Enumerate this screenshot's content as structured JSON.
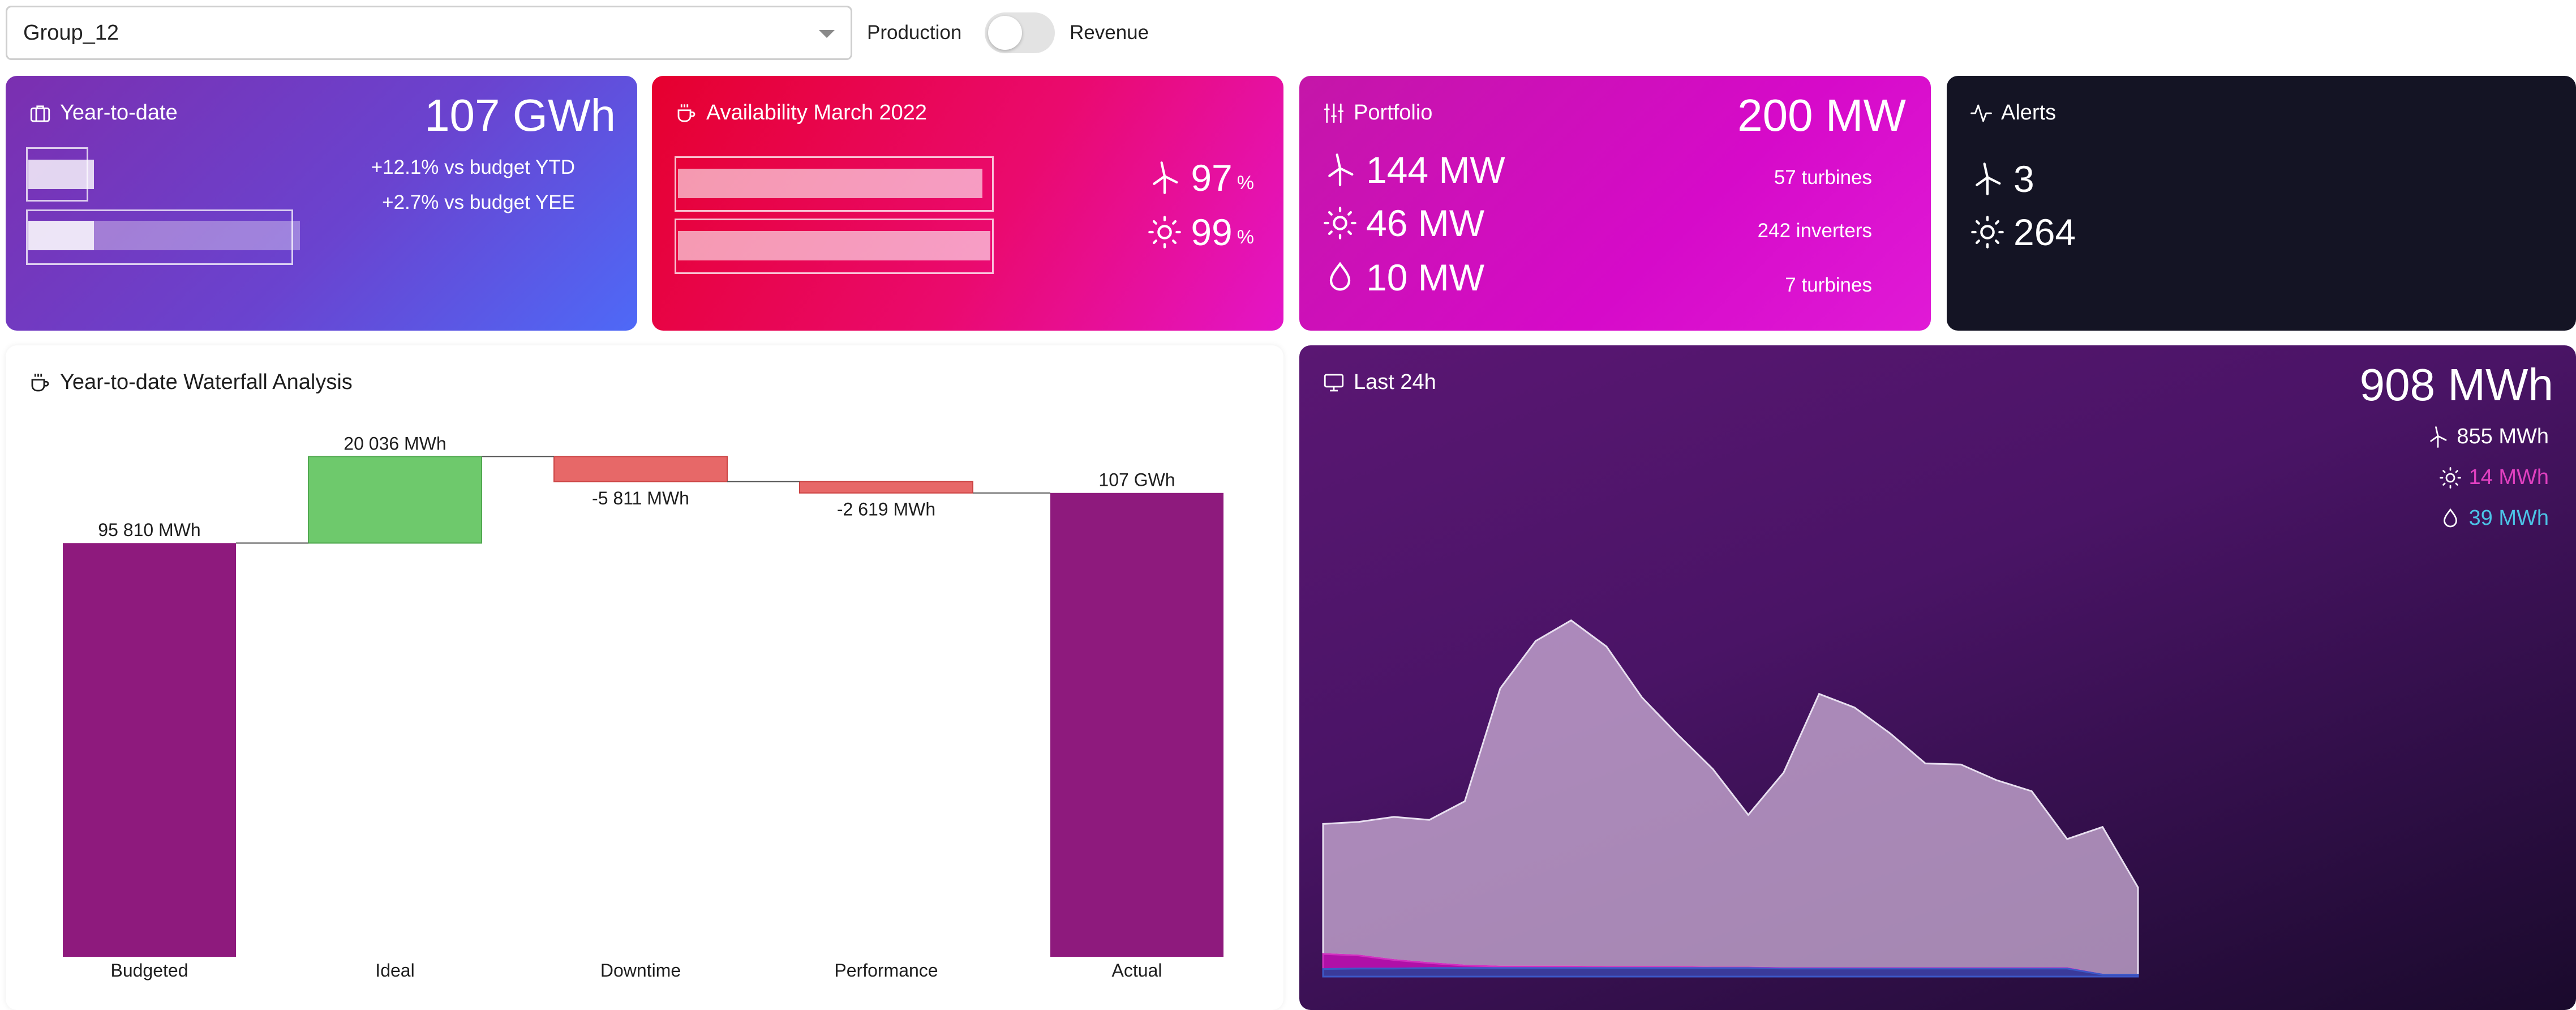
{
  "topbar": {
    "group_value": "Group_12",
    "toggle_left": "Production",
    "toggle_right": "Revenue"
  },
  "ytd": {
    "title": "Year-to-date",
    "value": "107 GWh",
    "line1": "+12.1% vs budget YTD",
    "line2": "+2.7% vs budget YEE"
  },
  "availability": {
    "title": "Availability March 2022",
    "wind": "97",
    "solar": "99",
    "unit": "%"
  },
  "portfolio": {
    "title": "Portfolio",
    "total": "200 MW",
    "wind": "144 MW",
    "solar": "46 MW",
    "hydro": "10 MW",
    "wind_units": "57 turbines",
    "solar_units": "242 inverters",
    "hydro_units": "7 turbines"
  },
  "alerts": {
    "title": "Alerts",
    "wind": "3",
    "solar": "264"
  },
  "waterfall": {
    "title": "Year-to-date Waterfall Analysis"
  },
  "last24": {
    "title": "Last 24h",
    "total": "908 MWh",
    "wind": "855 MWh",
    "solar": "14 MWh",
    "hydro": "39 MWh"
  },
  "colors": {
    "waterfall_total": "#8e1a7d",
    "waterfall_up": "#6ec96c",
    "waterfall_down": "#e76868",
    "solar_text": "#e040c0",
    "hydro_text": "#4cc3e6"
  },
  "chart_data": [
    {
      "type": "bar",
      "subtype": "waterfall",
      "title": "Year-to-date Waterfall Analysis",
      "categories": [
        "Budgeted",
        "Ideal",
        "Downtime",
        "Performance",
        "Actual"
      ],
      "values": [
        95810,
        20036,
        -5811,
        -2619,
        107416
      ],
      "value_labels": [
        "95 810 MWh",
        "20 036 MWh",
        "-5 811 MWh",
        "-2 619 MWh",
        "107 GWh"
      ],
      "unit": "MWh"
    },
    {
      "type": "area",
      "title": "Last 24h",
      "x": [
        0,
        1,
        2,
        3,
        4,
        5,
        6,
        7,
        8,
        9,
        10,
        11,
        12,
        13,
        14,
        15,
        16,
        17,
        18,
        19,
        20,
        21,
        22,
        23
      ],
      "series": [
        {
          "name": "wind",
          "values": [
            25.8,
            26.5,
            28.4,
            28.4,
            32.6,
            55.2,
            64.6,
            68.7,
            63.6,
            53.5,
            46.2,
            39.4,
            30.3,
            38.8,
            54.4,
            51.7,
            46.6,
            40.6,
            40.4,
            37.3,
            35.1,
            25.6,
            29.3,
            17.3
          ]
        },
        {
          "name": "solar",
          "values": [
            3.0,
            2.6,
            1.7,
            1.0,
            0.5,
            0.3,
            0.3,
            0.3,
            0.2,
            0.2,
            0.2,
            0.1,
            0.1,
            0.1,
            0.1,
            0.1,
            0.1,
            0.1,
            0.1,
            0.1,
            0.1,
            0.1,
            0.0,
            0.0
          ]
        },
        {
          "name": "hydro",
          "values": [
            1.5,
            1.6,
            1.6,
            1.7,
            1.7,
            1.7,
            1.7,
            1.7,
            1.7,
            1.7,
            1.7,
            1.7,
            1.7,
            1.6,
            1.6,
            1.6,
            1.6,
            1.6,
            1.6,
            1.6,
            1.6,
            1.6,
            0.4,
            0.4
          ]
        }
      ]
    }
  ]
}
